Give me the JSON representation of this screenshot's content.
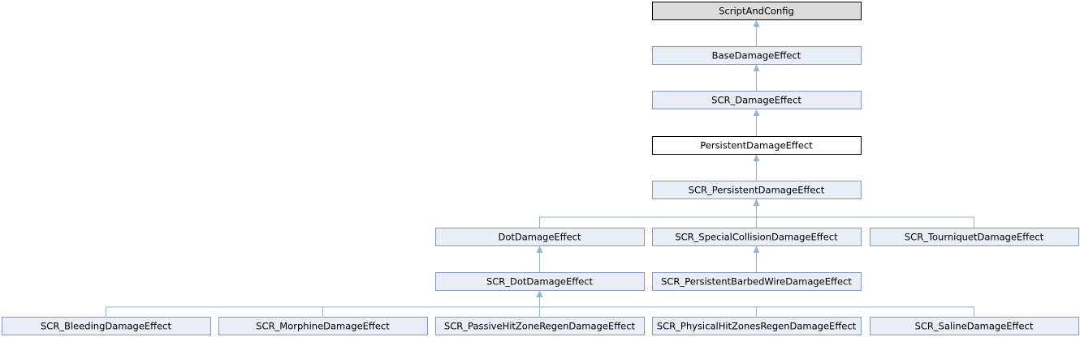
{
  "colors": {
    "node_fill": "#e8edf8",
    "node_border": "#8497c4",
    "root_fill": "#dcdcdc",
    "root_border": "#000000",
    "current_fill": "#ffffff",
    "current_border": "#000000",
    "edge": "#8fb4d6"
  },
  "nodes": [
    {
      "id": "scriptandconfig",
      "label": "ScriptAndConfig",
      "style": "root"
    },
    {
      "id": "basedamageeffect",
      "label": "BaseDamageEffect",
      "style": "normal"
    },
    {
      "id": "scr-damageeffect",
      "label": "SCR_DamageEffect",
      "style": "normal"
    },
    {
      "id": "persistentdamageeffect",
      "label": "PersistentDamageEffect",
      "style": "current"
    },
    {
      "id": "scr-persistentdamageeffect",
      "label": "SCR_PersistentDamageEffect",
      "style": "normal"
    },
    {
      "id": "dotdamageeffect",
      "label": "DotDamageEffect",
      "style": "normal"
    },
    {
      "id": "scr-specialcollisiondamageeffect",
      "label": "SCR_SpecialCollisionDamageEffect",
      "style": "normal"
    },
    {
      "id": "scr-tourniquetdamageeffect",
      "label": "SCR_TourniquetDamageEffect",
      "style": "normal"
    },
    {
      "id": "scr-dotdamageeffect",
      "label": "SCR_DotDamageEffect",
      "style": "normal"
    },
    {
      "id": "scr-persistentbarbedwiredamageeffect",
      "label": "SCR_PersistentBarbedWireDamageEffect",
      "style": "normal"
    },
    {
      "id": "scr-bleedingdamageeffect",
      "label": "SCR_BleedingDamageEffect",
      "style": "normal"
    },
    {
      "id": "scr-morphinedamageeffect",
      "label": "SCR_MorphineDamageEffect",
      "style": "normal"
    },
    {
      "id": "scr-passivehitzoneregendamageeffect",
      "label": "SCR_PassiveHitZoneRegenDamageEffect",
      "style": "normal"
    },
    {
      "id": "scr-physicalhitzonesregendamageeffect",
      "label": "SCR_PhysicalHitZonesRegenDamageEffect",
      "style": "normal"
    },
    {
      "id": "scr-salinedamageeffect",
      "label": "SCR_SalineDamageEffect",
      "style": "normal"
    }
  ],
  "edges": [
    {
      "from": "basedamageeffect",
      "to": "scriptandconfig"
    },
    {
      "from": "scr-damageeffect",
      "to": "basedamageeffect"
    },
    {
      "from": "persistentdamageeffect",
      "to": "scr-damageeffect"
    },
    {
      "from": "scr-persistentdamageeffect",
      "to": "persistentdamageeffect"
    },
    {
      "from": "dotdamageeffect",
      "to": "scr-persistentdamageeffect"
    },
    {
      "from": "scr-specialcollisiondamageeffect",
      "to": "scr-persistentdamageeffect"
    },
    {
      "from": "scr-tourniquetdamageeffect",
      "to": "scr-persistentdamageeffect"
    },
    {
      "from": "scr-dotdamageeffect",
      "to": "dotdamageeffect"
    },
    {
      "from": "scr-persistentbarbedwiredamageeffect",
      "to": "scr-specialcollisiondamageeffect"
    },
    {
      "from": "scr-bleedingdamageeffect",
      "to": "scr-dotdamageeffect"
    },
    {
      "from": "scr-morphinedamageeffect",
      "to": "scr-dotdamageeffect"
    },
    {
      "from": "scr-passivehitzoneregendamageeffect",
      "to": "scr-dotdamageeffect"
    },
    {
      "from": "scr-physicalhitzonesregendamageeffect",
      "to": "scr-dotdamageeffect"
    },
    {
      "from": "scr-salinedamageeffect",
      "to": "scr-dotdamageeffect"
    }
  ]
}
